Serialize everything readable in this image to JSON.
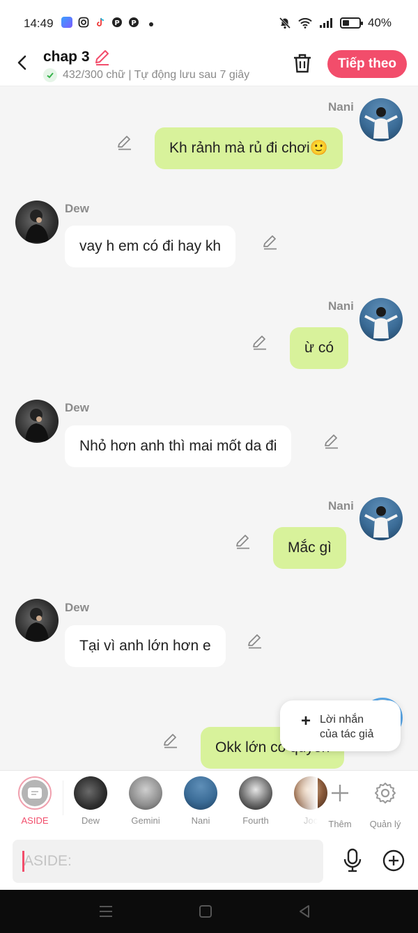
{
  "status_bar": {
    "time": "14:49",
    "battery": "40%",
    "battery_level": 0.4,
    "app_icons": [
      "messenger-icon",
      "instagram-icon",
      "tiktok-icon",
      "pinterest-icon",
      "pinterest-icon"
    ]
  },
  "header": {
    "title": "chap 3",
    "subtitle": "432/300 chữ | Tự động lưu sau 7 giây",
    "next_label": "Tiếp theo"
  },
  "colors": {
    "accent": "#f24d6b",
    "bubble_right": "#d8f29b",
    "bubble_left": "#ffffff",
    "background": "#f5f5f5"
  },
  "messages": [
    {
      "sender": "Nani",
      "side": "right",
      "text": "Kh rảnh mà rủ đi chơi🙂"
    },
    {
      "sender": "Dew",
      "side": "left",
      "text": "vay h em có đi hay kh"
    },
    {
      "sender": "Nani",
      "side": "right",
      "text": "ừ có"
    },
    {
      "sender": "Dew",
      "side": "left",
      "text": "Nhỏ hơn anh thì mai mốt da đi"
    },
    {
      "sender": "Nani",
      "side": "right",
      "text": "Mắc gì"
    },
    {
      "sender": "Dew",
      "side": "left",
      "text": "Tại vì anh lớn hơn e"
    },
    {
      "sender": "Nani",
      "side": "right",
      "text": "Okk lớn có quyền"
    }
  ],
  "popup": {
    "line1": "Lời nhắn",
    "line2": "của tác giả"
  },
  "characters": [
    {
      "label": "ASIDE"
    },
    {
      "label": "Dew"
    },
    {
      "label": "Gemini"
    },
    {
      "label": "Nani"
    },
    {
      "label": "Fourth"
    },
    {
      "label": "Joc"
    }
  ],
  "char_actions": {
    "add_label": "Thêm",
    "manage_label": "Quản lý"
  },
  "input": {
    "placeholder": "ASIDE:"
  }
}
